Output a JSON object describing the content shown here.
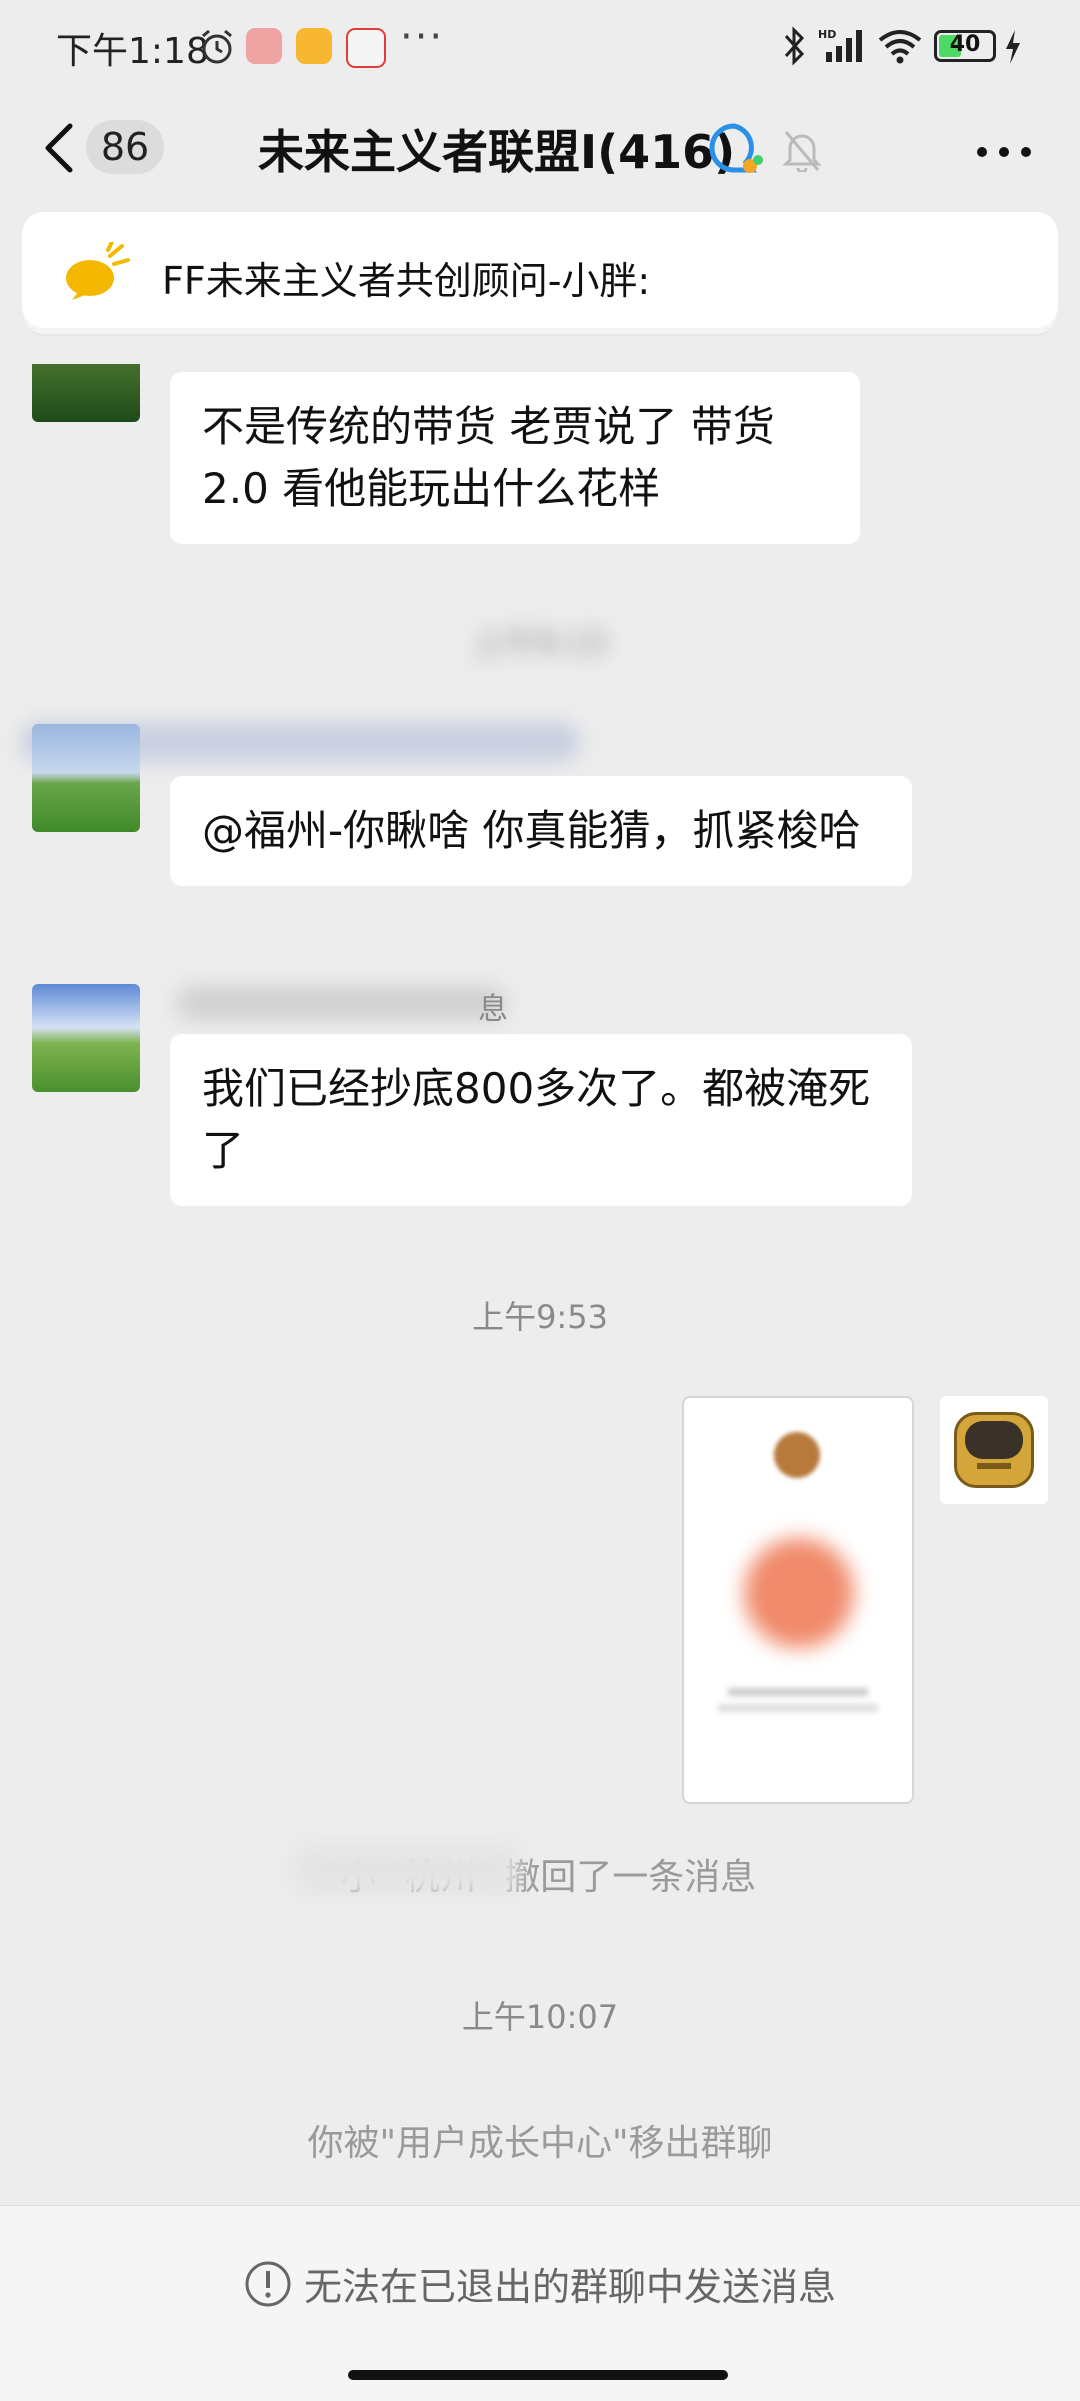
{
  "status_bar": {
    "time": "下午1:18",
    "more": "···",
    "battery": "40",
    "signal_label": "HD"
  },
  "nav": {
    "unread_count": "86",
    "title": "未来主义者联盟I(416)"
  },
  "notice": {
    "text": "FF未来主义者共创顾问-小胖:"
  },
  "messages": [
    {
      "text": "不是传统的带货 老贾说了 带货2.0 看他能玩出什么花样"
    },
    {
      "time": "上午9:15"
    },
    {
      "text": "@福州-你瞅啥  你真能猜，抓紧梭哈"
    },
    {
      "sender_suffix": "息"
    },
    {
      "text": "我们已经抄底800多次了。都被淹死了"
    },
    {
      "time": "上午9:53"
    },
    {
      "recall": "\"小   \"杭州\" 撤回了一条消息"
    },
    {
      "time": "上午10:07"
    },
    {
      "system": "你被\"用户成长中心\"移出群聊"
    }
  ],
  "bottom": {
    "notice": "无法在已退出的群聊中发送消息"
  },
  "colors": {
    "background": "#ededed",
    "bubble": "#ffffff",
    "secondary_text": "#8a8a8a",
    "notice_icon": "#f5b800"
  }
}
